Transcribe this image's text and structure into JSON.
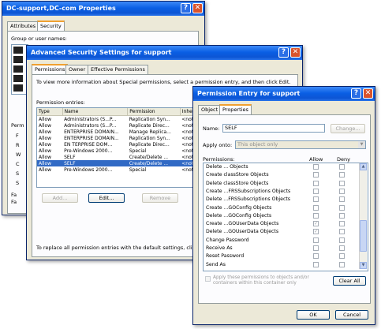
{
  "win1": {
    "title": "DC-support,DC-com Properties",
    "tabs": [
      "Attributes",
      "Security"
    ],
    "group_label": "Group or user names:",
    "perm_label": "Perm",
    "side_letters": [
      "F",
      "R",
      "W",
      "C",
      "S",
      "S"
    ],
    "fa_label": "Fa",
    "fa_text": "Fa"
  },
  "win2": {
    "title": "Advanced Security Settings for support",
    "tabs": [
      "Permissions",
      "Owner",
      "Effective Permissions"
    ],
    "info_text": "To view more information about Special permissions, select a permission entry, and then click Edit.",
    "entries_label": "Permission entries:",
    "columns": [
      "Type",
      "Name",
      "Permission",
      "Inheri"
    ],
    "rows": [
      {
        "type": "Allow",
        "name": "Administrators (S...P...",
        "perm": "Replication Syn...",
        "inh": "<not inh"
      },
      {
        "type": "Allow",
        "name": "Administrators (S...P...",
        "perm": "Replicate Direc...",
        "inh": "<not inh"
      },
      {
        "type": "Allow",
        "name": "ENTERPRISE DOMAIN...",
        "perm": "Manage Replica...",
        "inh": "<not inh"
      },
      {
        "type": "Allow",
        "name": "ENTERPRISE DOMAIN...",
        "perm": "Replication Syn...",
        "inh": "<not inh"
      },
      {
        "type": "Allow",
        "name": "EN TERPRISE DOM...",
        "perm": "Replicate Direc...",
        "inh": "<not inh"
      },
      {
        "type": "Allow",
        "name": "Pre-Windows 2000...",
        "perm": "Special",
        "inh": "<not inh"
      },
      {
        "type": "Allow",
        "name": "SELF",
        "perm": "Create/Delete ...",
        "inh": "<not inh"
      },
      {
        "type": "Allow",
        "name": "SELF",
        "perm": "Create/Delete ...",
        "inh": "<not inh"
      },
      {
        "type": "Allow",
        "name": "Pre-Windows 2000...",
        "perm": "Special",
        "inh": "<not inh"
      }
    ],
    "buttons": {
      "add": "Add...",
      "edit": "Edit...",
      "remove": "Remove"
    },
    "bottom_text": "To replace all permission entries with the default settings, click De"
  },
  "win3": {
    "title": "Permission Entry for support",
    "tabs": [
      "Object",
      "Properties"
    ],
    "name_label": "Name:",
    "name_value": "SELF",
    "change_button": "Change...",
    "apply_label": "Apply onto:",
    "apply_value": "This object only",
    "perm_label": "Permissions:",
    "allow_label": "Allow",
    "deny_label": "Deny",
    "permissions": [
      "Delete ... Objects",
      "Create classStore Objects",
      "Delete classStore Objects",
      "Create ...FRSSubscriptions Objects",
      "Delete ...FRSSubscriptions Objects",
      "Create ...GOConfig Objects",
      "Delete ...GOConfig Objects",
      "Create ...GOUserData Objects",
      "Delete ...GOUserData Objects",
      "Change Password",
      "Receive As",
      "Reset Password",
      "Send As"
    ],
    "checked_allow": [
      7,
      8
    ],
    "apply_checkbox": "Apply these permissions to objects and/or containers within this container only",
    "clear_all": "Clear All",
    "ok": "OK",
    "cancel": "Cancel"
  },
  "colors": {
    "title_blue": "#0a5fe4",
    "face": "#ece9d8",
    "select": "#316ac5"
  }
}
